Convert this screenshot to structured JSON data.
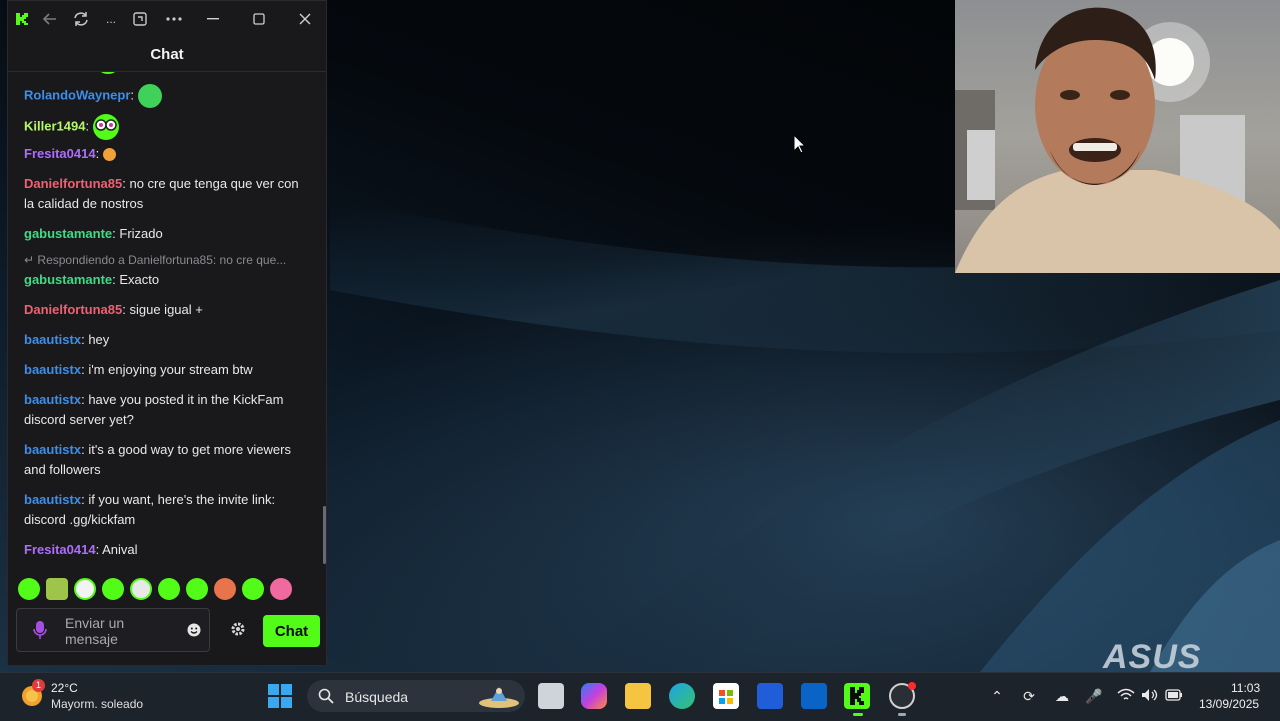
{
  "chat": {
    "header_title": "Chat",
    "reply_context": "Respondiendo a Danielfortuna85: no cre que...",
    "messages": [
      {
        "user": "RolandoWaynepr",
        "sep": ":",
        "text": "",
        "color": "#3d8eea",
        "emote": "big-green-emote"
      },
      {
        "user": "Killer1494",
        "sep": ":",
        "text": "",
        "color": "#b7f56a",
        "emote": "goggles-emote"
      },
      {
        "user": "Fresita0414",
        "sep": ":",
        "text": "",
        "color": "#b06cff",
        "emote": "small-face-emote"
      },
      {
        "user": "Danielfortuna85",
        "sep": ":",
        "text": " no cre que tenga que ver con la calidad de nostros",
        "color": "#f06073"
      },
      {
        "user": "gabustamante",
        "sep": ":",
        "text": " Frizado",
        "color": "#3ddc84"
      },
      {
        "user": "gabustamante",
        "sep": ":",
        "text": " Exacto",
        "color": "#3ddc84"
      },
      {
        "user": "Danielfortuna85",
        "sep": ":",
        "text": " sigue igual +",
        "color": "#f06073"
      },
      {
        "user": "baautistx",
        "sep": ":",
        "text": " hey",
        "color": "#3d8eea"
      },
      {
        "user": "baautistx",
        "sep": ":",
        "text": " i'm enjoying your stream btw",
        "color": "#3d8eea"
      },
      {
        "user": "baautistx",
        "sep": ":",
        "text": " have you posted it in the KickFam discord server yet?",
        "color": "#3d8eea"
      },
      {
        "user": "baautistx",
        "sep": ":",
        "text": " it's a good way to get more viewers and followers",
        "color": "#3d8eea"
      },
      {
        "user": "baautistx",
        "sep": ":",
        "text": " if you want, here's the invite link: discord .gg/kickfam",
        "color": "#3d8eea"
      },
      {
        "user": "Fresita0414",
        "sep": ":",
        "text": " Anival",
        "color": "#b06cff"
      }
    ],
    "input_placeholder": "Enviar un mensaje",
    "send_label": "Chat",
    "accent_color": "#53fc18"
  },
  "window_controls": {
    "more_label": "..."
  },
  "taskbar": {
    "weather": {
      "badge": "1",
      "temperature": "22°C",
      "condition": "Mayorm. soleado"
    },
    "search_placeholder": "Búsqueda",
    "clock": {
      "time": "11:03",
      "date": "13/09/2025"
    }
  },
  "desktop": {
    "brand": "ASUS"
  }
}
